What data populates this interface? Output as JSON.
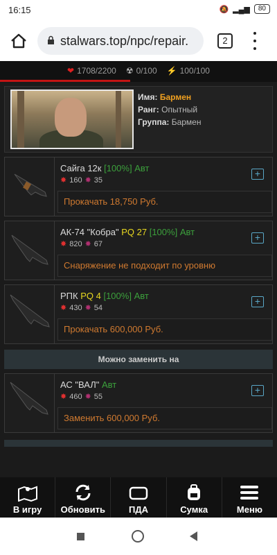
{
  "status": {
    "time": "16:15",
    "battery": "80"
  },
  "browser": {
    "url": "stalwars.top/npc/repair.",
    "tab_count": "2"
  },
  "stats": {
    "health": "1708/2200",
    "radiation": "0/100",
    "energy": "100/100"
  },
  "profile": {
    "name_label": "Имя:",
    "name": "Бармен",
    "rank_label": "Ранг:",
    "rank": "Опытный",
    "group_label": "Группа:",
    "group": "Бармен"
  },
  "items": [
    {
      "name": "Сайга 12к",
      "pq": "",
      "condition": "[100%]",
      "auto": "Авт",
      "dmg": "160",
      "stat2": "35",
      "action": "Прокачать 18,750 Руб."
    },
    {
      "name": "АК-74 \"Кобра\"",
      "pq": "PQ 27",
      "condition": "[100%]",
      "auto": "Авт",
      "dmg": "820",
      "stat2": "67",
      "action": "Снаряжение не подходит по уровню"
    },
    {
      "name": "РПК",
      "pq": "PQ 4",
      "condition": "[100%]",
      "auto": "Авт",
      "dmg": "430",
      "stat2": "54",
      "action": "Прокачать 600,000 Руб."
    }
  ],
  "replace_header": "Можно заменить на",
  "replacement": {
    "name": "АС \"ВАЛ\"",
    "pq": "",
    "condition": "",
    "auto": "Авт",
    "dmg": "460",
    "stat2": "55",
    "action": "Заменить 600,000 Руб."
  },
  "nav": {
    "to_game": "В игру",
    "refresh": "Обновить",
    "pda": "ПДА",
    "bag": "Сумка",
    "menu": "Меню"
  }
}
